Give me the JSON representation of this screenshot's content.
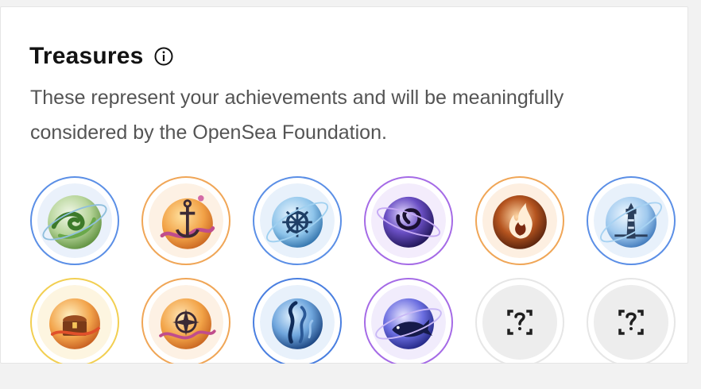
{
  "section": {
    "title": "Treasures",
    "info_icon": "info-circle-icon",
    "description": "These represent your achievements and will be meaningfully considered by the OpenSea Foundation."
  },
  "treasures": [
    {
      "icon": "wind-swirl-orb-icon",
      "ring_color": "#5b8fe6",
      "status": "unlocked"
    },
    {
      "icon": "anchor-orb-icon",
      "ring_color": "#f0a657",
      "status": "unlocked"
    },
    {
      "icon": "ship-wheel-orb-icon",
      "ring_color": "#5b8fe6",
      "status": "unlocked"
    },
    {
      "icon": "vortex-orb-icon",
      "ring_color": "#a56be6",
      "status": "unlocked"
    },
    {
      "icon": "flame-orb-icon",
      "ring_color": "#f0a657",
      "status": "unlocked"
    },
    {
      "icon": "lighthouse-orb-icon",
      "ring_color": "#5b8fe6",
      "status": "unlocked"
    },
    {
      "icon": "treasure-chest-orb-icon",
      "ring_color": "#f2cf52",
      "status": "unlocked"
    },
    {
      "icon": "compass-orb-icon",
      "ring_color": "#f0a657",
      "status": "unlocked"
    },
    {
      "icon": "kelp-orb-icon",
      "ring_color": "#4a7fe0",
      "status": "unlocked"
    },
    {
      "icon": "whale-orb-icon",
      "ring_color": "#a56be6",
      "status": "unlocked"
    },
    {
      "icon": "unknown-treasure-icon",
      "ring_color": "#e6e6e6",
      "status": "locked"
    },
    {
      "icon": "unknown-treasure-icon",
      "ring_color": "#e6e6e6",
      "status": "locked"
    }
  ]
}
